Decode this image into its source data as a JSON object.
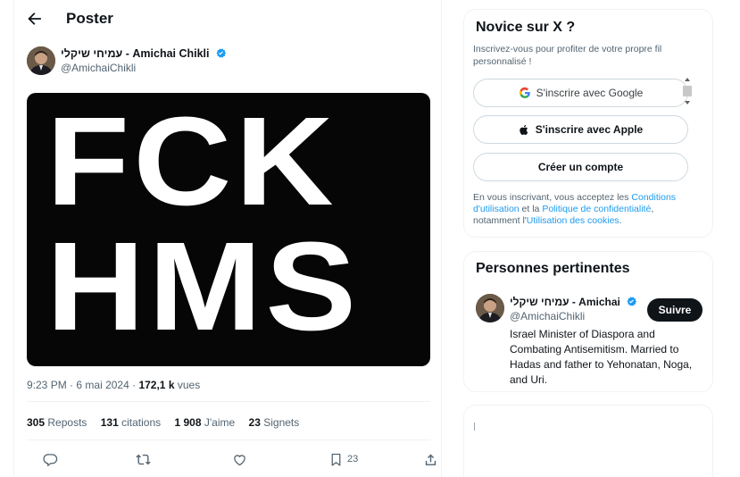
{
  "header": {
    "title": "Poster"
  },
  "post": {
    "author_name": "עמיחי שיקלי - Amichai Chikli",
    "author_handle": "@AmichaiChikli",
    "image_text_line1": "FCK",
    "image_text_line2": "HMS",
    "time": "9:23 PM",
    "date": "6 mai 2024",
    "views_count": "172,1 k",
    "views_label": "vues",
    "reposts_count": "305",
    "reposts_label": "Reposts",
    "quotes_count": "131",
    "quotes_label": "citations",
    "likes_count": "1 908",
    "likes_label": "J'aime",
    "bookmarks_count": "23",
    "bookmarks_label": "Signets",
    "action_bookmark_count": "23"
  },
  "signup": {
    "title": "Novice sur X ?",
    "subtitle": "Inscrivez-vous pour profiter de votre propre fil personnalisé !",
    "google_label": "S'inscrire avec Google",
    "apple_label": "S'inscrire avec Apple",
    "create_label": "Créer un compte",
    "legal_prefix": "En vous inscrivant, vous acceptez les ",
    "terms_link": "Conditions d'utilisation",
    "legal_and": " et la ",
    "privacy_link": "Politique de confidentialité",
    "legal_comma": ", notamment l'",
    "cookies_link": "Utilisation des cookies",
    "legal_end": "."
  },
  "related": {
    "title": "Personnes pertinentes",
    "name": "עמיחי שיקלי - Amichai",
    "handle": "@AmichaiChikli",
    "follow_label": "Suivre",
    "bio": "Israel Minister of Diaspora and Combating Antisemitism. Married to Hadas and father to Yehonatan, Noga, and Uri."
  },
  "icons": [
    "back-arrow-icon",
    "verified-badge-icon",
    "google-icon",
    "apple-icon",
    "reply-icon",
    "repost-icon",
    "like-icon",
    "bookmark-icon",
    "share-icon"
  ],
  "colors": {
    "accent": "#1d9bf0",
    "text": "#0f1419",
    "muted": "#536471",
    "border": "#eff3f4",
    "image_bg": "#060606"
  }
}
